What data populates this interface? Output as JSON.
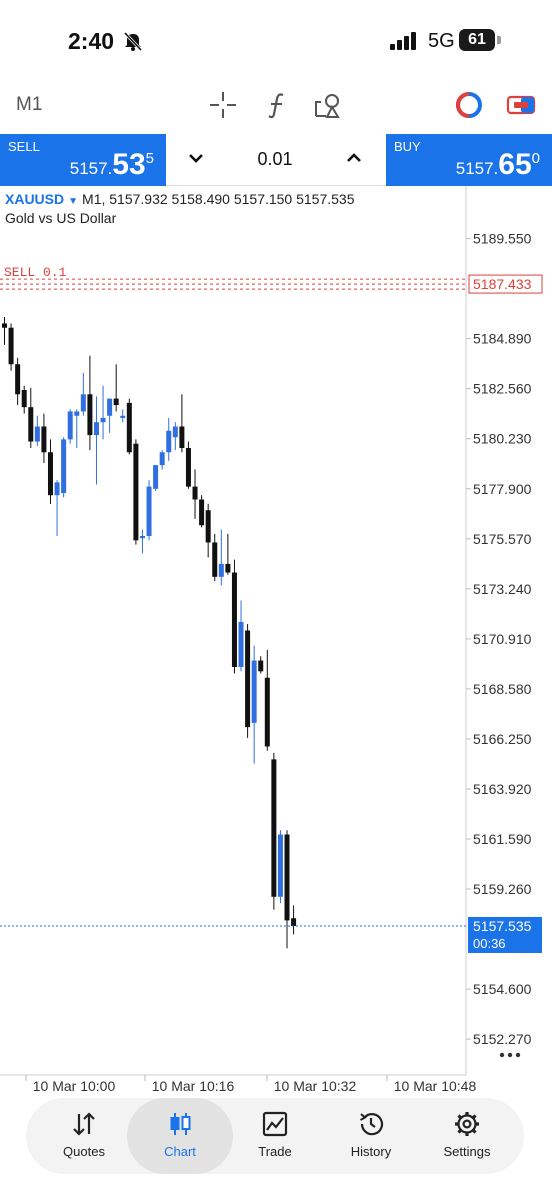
{
  "status_bar": {
    "time": "2:40",
    "network": "5G",
    "battery": "61"
  },
  "toolbar": {
    "timeframe": "M1",
    "tools": [
      "crosshair-icon",
      "indicators-icon",
      "objects-icon",
      "theme-icon",
      "one-click-trading-icon"
    ]
  },
  "trade_panel": {
    "sell_label": "SELL",
    "sell_price_prefix": "5157.",
    "sell_price_big": "53",
    "sell_price_sup": "5",
    "lot": "0.01",
    "buy_label": "BUY",
    "buy_price_prefix": "5157.",
    "buy_price_big": "65",
    "buy_price_sup": "0"
  },
  "colors": {
    "accent": "#1a73e8",
    "bull_candle": "#2f6fe0",
    "bear_candle": "#111111",
    "order_line": "#e0403a"
  },
  "chart_header": {
    "symbol": "XAUUSD",
    "timeframe": "M1,",
    "ohlc": "5157.932 5158.490 5157.150 5157.535",
    "description": "Gold vs US Dollar"
  },
  "price_axis": [
    "5189.550",
    "5184.890",
    "5182.560",
    "5180.230",
    "5177.900",
    "5175.570",
    "5173.240",
    "5170.910",
    "5168.580",
    "5166.250",
    "5163.920",
    "5161.590",
    "5159.260",
    "5154.600",
    "5152.270"
  ],
  "time_axis": [
    "10 Mar 10:00",
    "10 Mar 10:16",
    "10 Mar 10:32",
    "10 Mar 10:48"
  ],
  "order_line": {
    "label": "SELL 0.1",
    "price_label": "5187.433"
  },
  "current_price": {
    "price": "5157.535",
    "countdown": "00:36"
  },
  "chart_data": {
    "type": "candlestick",
    "symbol": "XAUUSD",
    "timeframe": "M1",
    "ylim": [
      5150.6,
      5192.0
    ],
    "candles": [
      {
        "o": 5185.6,
        "h": 5185.9,
        "l": 5184.6,
        "c": 5185.4
      },
      {
        "o": 5185.4,
        "h": 5185.6,
        "l": 5183.4,
        "c": 5183.7
      },
      {
        "o": 5183.7,
        "h": 5184.0,
        "l": 5181.8,
        "c": 5182.3
      },
      {
        "o": 5182.5,
        "h": 5182.7,
        "l": 5181.4,
        "c": 5181.7
      },
      {
        "o": 5181.7,
        "h": 5182.6,
        "l": 5179.8,
        "c": 5180.1
      },
      {
        "o": 5180.1,
        "h": 5181.3,
        "l": 5179.9,
        "c": 5180.8
      },
      {
        "o": 5180.8,
        "h": 5181.4,
        "l": 5179.1,
        "c": 5179.6
      },
      {
        "o": 5179.6,
        "h": 5180.2,
        "l": 5177.2,
        "c": 5177.6
      },
      {
        "o": 5177.6,
        "h": 5178.3,
        "l": 5175.7,
        "c": 5178.2
      },
      {
        "o": 5177.7,
        "h": 5180.3,
        "l": 5177.5,
        "c": 5180.2
      },
      {
        "o": 5180.2,
        "h": 5181.6,
        "l": 5180.0,
        "c": 5181.5
      },
      {
        "o": 5181.3,
        "h": 5181.6,
        "l": 5179.8,
        "c": 5181.5
      },
      {
        "o": 5181.5,
        "h": 5183.3,
        "l": 5181.3,
        "c": 5182.3
      },
      {
        "o": 5182.3,
        "h": 5184.1,
        "l": 5179.7,
        "c": 5180.4
      },
      {
        "o": 5180.4,
        "h": 5182.2,
        "l": 5178.1,
        "c": 5181.0
      },
      {
        "o": 5181.0,
        "h": 5182.7,
        "l": 5180.2,
        "c": 5181.2
      },
      {
        "o": 5181.3,
        "h": 5181.7,
        "l": 5180.5,
        "c": 5182.1
      },
      {
        "o": 5182.1,
        "h": 5183.7,
        "l": 5181.5,
        "c": 5181.8
      },
      {
        "o": 5181.2,
        "h": 5181.6,
        "l": 5181.0,
        "c": 5181.3
      },
      {
        "o": 5181.9,
        "h": 5182.1,
        "l": 5179.5,
        "c": 5179.6
      },
      {
        "o": 5180.0,
        "h": 5180.2,
        "l": 5175.3,
        "c": 5175.5
      },
      {
        "o": 5175.6,
        "h": 5176.0,
        "l": 5174.9,
        "c": 5175.7
      },
      {
        "o": 5175.7,
        "h": 5178.3,
        "l": 5175.5,
        "c": 5178.0
      },
      {
        "o": 5177.9,
        "h": 5179.0,
        "l": 5177.8,
        "c": 5179.0
      },
      {
        "o": 5179.0,
        "h": 5179.7,
        "l": 5178.8,
        "c": 5179.6
      },
      {
        "o": 5179.6,
        "h": 5181.2,
        "l": 5179.2,
        "c": 5180.6
      },
      {
        "o": 5180.3,
        "h": 5181.0,
        "l": 5179.7,
        "c": 5180.8
      },
      {
        "o": 5180.8,
        "h": 5182.3,
        "l": 5179.6,
        "c": 5179.8
      },
      {
        "o": 5179.8,
        "h": 5180.1,
        "l": 5177.9,
        "c": 5178.0
      },
      {
        "o": 5178.0,
        "h": 5178.8,
        "l": 5176.5,
        "c": 5177.4
      },
      {
        "o": 5177.4,
        "h": 5177.6,
        "l": 5176.1,
        "c": 5176.2
      },
      {
        "o": 5176.9,
        "h": 5177.2,
        "l": 5174.7,
        "c": 5175.4
      },
      {
        "o": 5175.4,
        "h": 5175.8,
        "l": 5173.6,
        "c": 5173.8
      },
      {
        "o": 5173.8,
        "h": 5176.0,
        "l": 5173.4,
        "c": 5174.4
      },
      {
        "o": 5174.4,
        "h": 5175.8,
        "l": 5173.9,
        "c": 5174.0
      },
      {
        "o": 5174.0,
        "h": 5174.6,
        "l": 5169.3,
        "c": 5169.6
      },
      {
        "o": 5169.6,
        "h": 5172.7,
        "l": 5169.4,
        "c": 5171.7
      },
      {
        "o": 5171.3,
        "h": 5171.6,
        "l": 5166.3,
        "c": 5166.8
      },
      {
        "o": 5167.0,
        "h": 5170.6,
        "l": 5165.1,
        "c": 5169.9
      },
      {
        "o": 5169.9,
        "h": 5170.1,
        "l": 5169.3,
        "c": 5169.4
      },
      {
        "o": 5169.1,
        "h": 5170.4,
        "l": 5165.7,
        "c": 5165.9
      },
      {
        "o": 5165.3,
        "h": 5165.6,
        "l": 5158.3,
        "c": 5158.9
      },
      {
        "o": 5158.9,
        "h": 5162.0,
        "l": 5158.6,
        "c": 5161.8
      },
      {
        "o": 5161.8,
        "h": 5162.0,
        "l": 5156.5,
        "c": 5157.8
      },
      {
        "o": 5157.9,
        "h": 5158.5,
        "l": 5157.15,
        "c": 5157.54
      }
    ]
  },
  "bottom_nav": {
    "items": [
      {
        "label": "Quotes",
        "icon": "quotes-arrows-icon"
      },
      {
        "label": "Chart",
        "icon": "candlestick-icon"
      },
      {
        "label": "Trade",
        "icon": "trade-chart-icon"
      },
      {
        "label": "History",
        "icon": "history-clock-icon"
      },
      {
        "label": "Settings",
        "icon": "gear-icon"
      }
    ]
  }
}
